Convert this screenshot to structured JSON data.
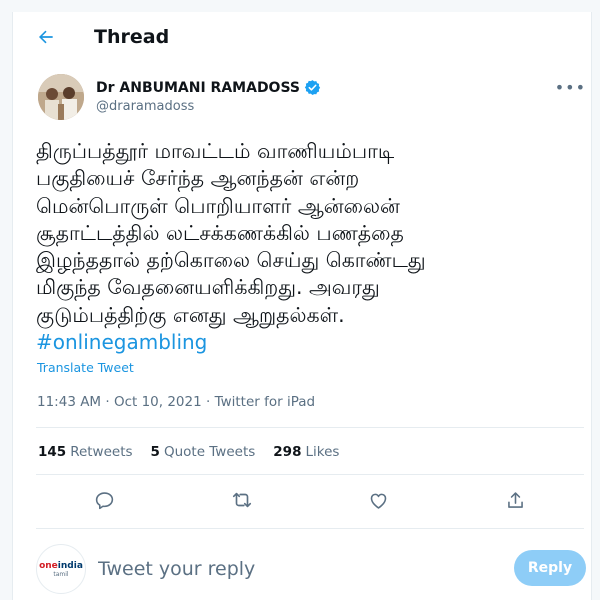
{
  "header": {
    "title": "Thread"
  },
  "author": {
    "name": "Dr ANBUMANI RAMADOSS",
    "handle": "@draramadoss"
  },
  "tweet": {
    "lines": [
      "திருப்பத்தூர் மாவட்டம் வாணியம்பாடி",
      "பகுதியைச் சேர்ந்த ஆனந்தன் என்ற",
      "மென்பொருள் பொறியாளர் ஆன்லைன்",
      "சூதாட்டத்தில் லட்சக்கணக்கில் பணத்தை",
      "இழந்ததால் தற்கொலை செய்து கொண்டது",
      "மிகுந்த வேதனையளிக்கிறது. அவரது",
      "குடும்பத்திற்கு எனது ஆறுதல்கள்."
    ],
    "hashtag": "#onlinegambling",
    "translate": "Translate Tweet",
    "meta": "11:43 AM · Oct 10, 2021 · Twitter for iPad"
  },
  "stats": {
    "retweets_count": "145",
    "retweets_label": "Retweets",
    "quotes_count": "5",
    "quotes_label": "Quote Tweets",
    "likes_count": "298",
    "likes_label": "Likes"
  },
  "reply": {
    "placeholder": "Tweet your reply",
    "button": "Reply",
    "avatar_brand_1": "one",
    "avatar_brand_2": "india",
    "avatar_sub": "tamil"
  },
  "colors": {
    "accent": "#1b95e0",
    "verified": "#1da1f2",
    "reply_button": "#8ecdf7",
    "muted": "#5b7083"
  },
  "icons": [
    "back-arrow-icon",
    "verified-badge-icon",
    "more-icon",
    "reply-icon",
    "retweet-icon",
    "like-icon",
    "share-icon"
  ]
}
